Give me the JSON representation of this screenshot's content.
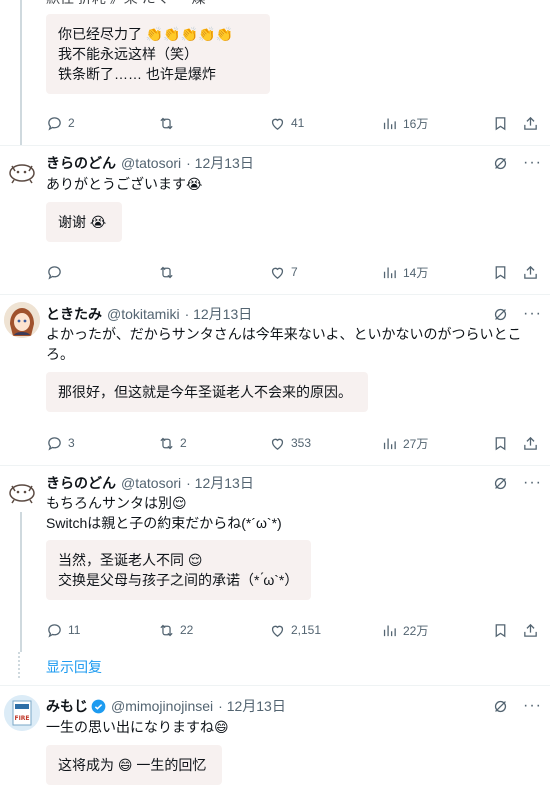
{
  "colors": {
    "accent": "#1d9bf0",
    "muted": "#536471",
    "translation_bg": "#f7f1f0"
  },
  "top_tweet": {
    "partial_text": "默往 折耗 》乘 たく  ー 燥",
    "translation": [
      "你已经尽力了 👏👏👏👏👏",
      "我不能永远这样（笑）",
      "铁条断了…… 也许是爆炸"
    ],
    "stats": {
      "replies": "2",
      "retweets": "",
      "likes": "41",
      "views": "16万"
    }
  },
  "tweets": [
    {
      "name": "きらのどん",
      "handle": "@tatosori",
      "date": "· 12月13日",
      "text": "ありがとうございます😭",
      "translation": [
        "谢谢 😭"
      ],
      "stats": {
        "replies": "",
        "retweets": "",
        "likes": "7",
        "views": "14万"
      }
    },
    {
      "name": "ときたみ",
      "handle": "@tokitamiki",
      "date": "· 12月13日",
      "text": "よかったが、だからサンタさんは今年来ないよ、といかないのがつらいところ。",
      "translation": [
        "那很好，但这就是今年圣诞老人不会来的原因。"
      ],
      "stats": {
        "replies": "3",
        "retweets": "2",
        "likes": "353",
        "views": "27万"
      }
    },
    {
      "name": "きらのどん",
      "handle": "@tatosori",
      "date": "· 12月13日",
      "text_lines": [
        "もちろんサンタは別😌",
        "Switchは親と子の約束だからね(*´ω`*)"
      ],
      "translation": [
        "当然，圣诞老人不同 😌",
        "交换是父母与孩子之间的承诺（* ́ω`*）"
      ],
      "stats": {
        "replies": "11",
        "retweets": "22",
        "likes": "2,151",
        "views": "22万"
      }
    },
    {
      "name": "みもじ",
      "handle": "@mimojinojinsei",
      "date": "· 12月13日",
      "text": "一生の思い出になりますね😄",
      "translation": [
        "这将成为 😄 一生的回忆"
      ]
    }
  ],
  "show_replies_label": "显示回复",
  "icons": [
    "reply-icon",
    "retweet-icon",
    "like-icon",
    "views-icon",
    "bookmark-icon",
    "share-icon",
    "grok-icon",
    "more-icon",
    "verified-icon"
  ]
}
